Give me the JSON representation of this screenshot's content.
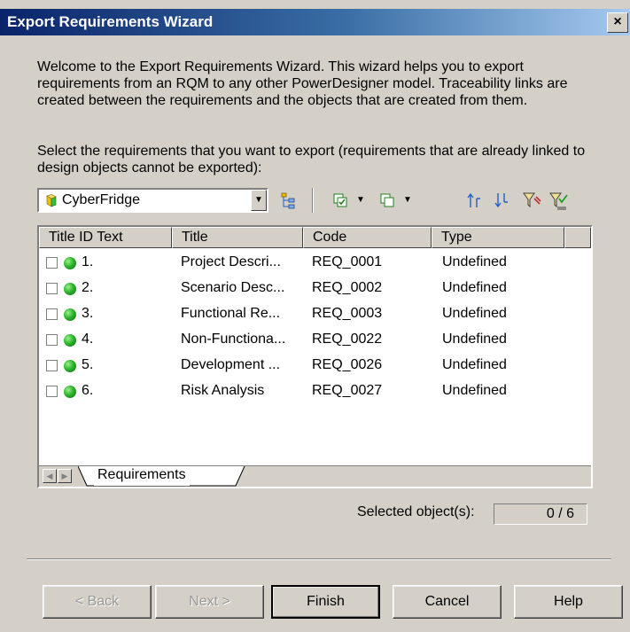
{
  "window": {
    "title": "Export Requirements Wizard",
    "close_label": "×"
  },
  "intro_text": "Welcome to the Export Requirements Wizard. This wizard helps you to export requirements from an RQM to any other PowerDesigner model. Traceability links are created between the requirements and the objects that are created from them.",
  "prompt_text": "Select the requirements that you want to export (requirements that are already linked to design objects cannot be exported):",
  "model_selector": {
    "selected": "CyberFridge",
    "icon": "model-icon"
  },
  "toolbar": {
    "icons": [
      "hierarchy-icon",
      "select-all-icon",
      "deselect-all-icon",
      "move-up-icon",
      "move-down-icon",
      "filter-icon",
      "clear-filter-icon"
    ]
  },
  "table": {
    "columns": [
      "Title ID Text",
      "Title",
      "Code",
      "Type"
    ],
    "rows": [
      {
        "id": "1.",
        "title": "Project Descri...",
        "code": "REQ_0001",
        "type": "Undefined"
      },
      {
        "id": "2.",
        "title": "Scenario Desc...",
        "code": "REQ_0002",
        "type": "Undefined"
      },
      {
        "id": "3.",
        "title": "Functional Re...",
        "code": "REQ_0003",
        "type": "Undefined"
      },
      {
        "id": "4.",
        "title": "Non-Functiona...",
        "code": "REQ_0022",
        "type": "Undefined"
      },
      {
        "id": "5.",
        "title": "Development ...",
        "code": "REQ_0026",
        "type": "Undefined"
      },
      {
        "id": "6.",
        "title": "Risk Analysis",
        "code": "REQ_0027",
        "type": "Undefined"
      }
    ]
  },
  "tabs": [
    "Requirements"
  ],
  "status": {
    "label": "Selected object(s):",
    "value": "0 / 6"
  },
  "buttons": {
    "back": "< Back",
    "next": "Next >",
    "finish": "Finish",
    "cancel": "Cancel",
    "help": "Help"
  },
  "colors": {
    "title_bar": "#0a246a",
    "dialog_bg": "#d4d0c8",
    "status_dot": "#2db52d"
  }
}
